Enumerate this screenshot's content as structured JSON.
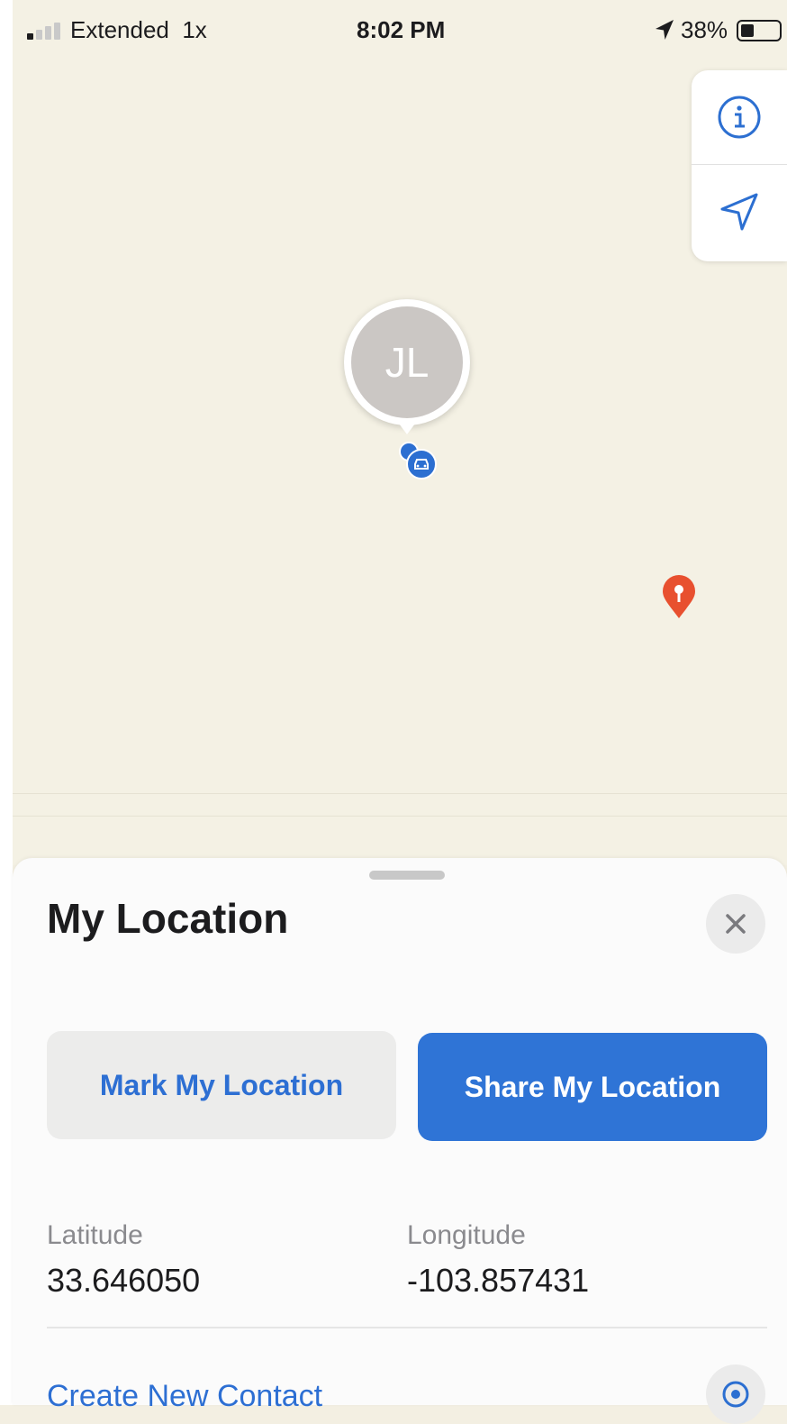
{
  "status_bar": {
    "carrier": "Extended  1x",
    "time": "8:02 PM",
    "battery_percent": "38%",
    "signal_bars_active": 1
  },
  "map": {
    "annotation_initials": "JL",
    "controls": {
      "info_icon": "info-circle-icon",
      "locate_icon": "location-arrow-icon"
    },
    "accent_color": "#2c6fd1",
    "pin_color": "#e8502f"
  },
  "sheet": {
    "title": "My Location",
    "mark_button": "Mark My Location",
    "share_button": "Share My Location",
    "latitude_label": "Latitude",
    "latitude_value": "33.646050",
    "longitude_label": "Longitude",
    "longitude_value": "-103.857431",
    "create_contact": "Create New Contact"
  }
}
